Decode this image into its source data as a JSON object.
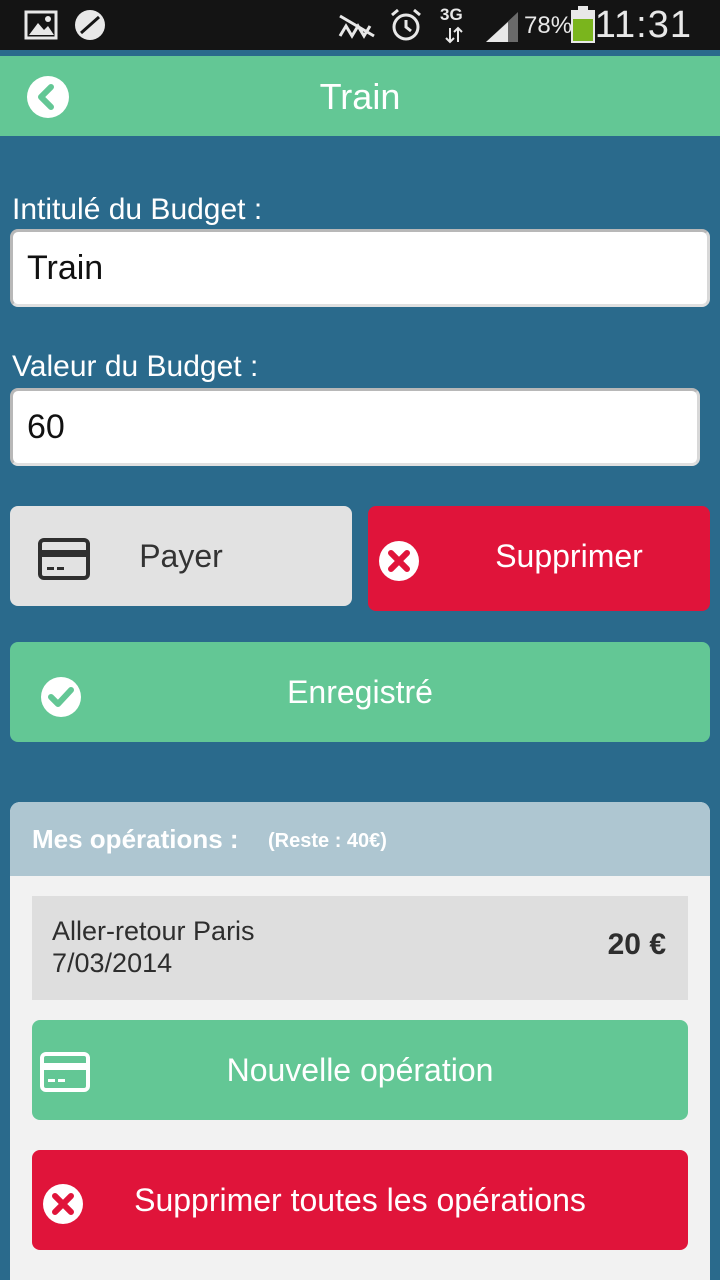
{
  "status_bar": {
    "network": "3G",
    "battery": "78%",
    "time": "11:31",
    "icons": [
      "image-icon",
      "sync-icon",
      "mute-icon",
      "alarm-icon",
      "data-arrows-icon",
      "signal-icon",
      "battery-icon"
    ]
  },
  "header": {
    "title": "Train",
    "back_icon": "back-arrow-icon"
  },
  "form": {
    "name_label": "Intitulé du Budget :",
    "name_value": "Train",
    "value_label": "Valeur du Budget :",
    "value_value": "60"
  },
  "actions": {
    "pay_label": "Payer",
    "pay_icon": "credit-card-icon",
    "delete_label": "Supprimer",
    "delete_icon": "close-circle-icon",
    "save_label": "Enregistré",
    "save_icon": "check-circle-icon"
  },
  "operations": {
    "title": "Mes opérations :",
    "remaining": "(Reste : 40€)",
    "items": [
      {
        "name": "Aller-retour Paris",
        "date": "7/03/2014",
        "amount": "20 €"
      }
    ],
    "new_label": "Nouvelle opération",
    "delete_all_label": "Supprimer toutes les opérations"
  },
  "colors": {
    "background": "#2a6a8c",
    "green": "#63c795",
    "red": "#e0143a",
    "grey_button": "#e2e2e2",
    "card_header": "#aec6d1"
  }
}
